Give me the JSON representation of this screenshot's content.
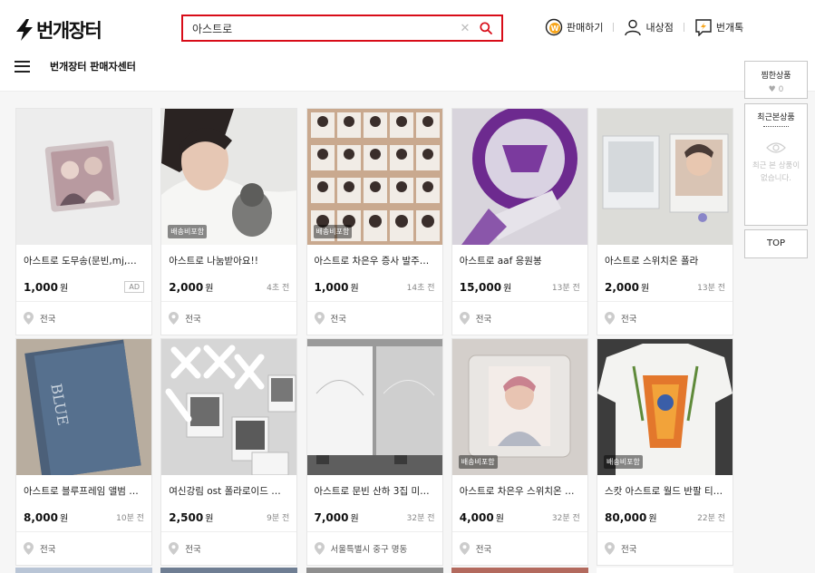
{
  "header": {
    "logo": "번개장터",
    "search": {
      "value": "아스트로",
      "placeholder": ""
    },
    "menu": [
      {
        "label": "판매하기",
        "icon": "sell-won-icon"
      },
      {
        "label": "내상점",
        "icon": "user-icon"
      },
      {
        "label": "번개톡",
        "icon": "chat-icon"
      }
    ],
    "seller_center": "번개장터 판매자센터"
  },
  "products": [
    {
      "title": "아스트로 도무송(문빈,mj,차…",
      "price": "1,000",
      "unit": "원",
      "time": "",
      "ad": "AD",
      "badge": "",
      "location": "전국"
    },
    {
      "title": "아스트로 나눔받아요!!",
      "price": "2,000",
      "unit": "원",
      "time": "4초 전",
      "ad": "",
      "badge": "배송비포함",
      "location": "전국"
    },
    {
      "title": "아스트로 차은우 증사 발주한…",
      "price": "1,000",
      "unit": "원",
      "time": "14초 전",
      "ad": "",
      "badge": "배송비포함",
      "location": "전국"
    },
    {
      "title": "아스트로 aaf 응원봉",
      "price": "15,000",
      "unit": "원",
      "time": "13분 전",
      "ad": "",
      "badge": "",
      "location": "전국"
    },
    {
      "title": "아스트로 스위치온 폴라",
      "price": "2,000",
      "unit": "원",
      "time": "13분 전",
      "ad": "",
      "badge": "",
      "location": "전국"
    },
    {
      "title": "아스트로 블루프레임 앨범 일괄",
      "price": "8,000",
      "unit": "원",
      "time": "10분 전",
      "ad": "",
      "badge": "",
      "location": "전국"
    },
    {
      "title": "여신강림 ost 폴라로이드 아…",
      "price": "2,500",
      "unit": "원",
      "time": "9분 전",
      "ad": "",
      "badge": "",
      "location": "전국"
    },
    {
      "title": "아스트로 문빈 산하 3집 미개…",
      "price": "7,000",
      "unit": "원",
      "time": "32분 전",
      "ad": "",
      "badge": "",
      "location": "서울특별시 중구 명동"
    },
    {
      "title": "아스트로 차은우 스위치온 포…",
      "price": "4,000",
      "unit": "원",
      "time": "32분 전",
      "ad": "",
      "badge": "배송비포함",
      "location": "전국"
    },
    {
      "title": "스캇 아스트로 월드 반팔 티…",
      "price": "80,000",
      "unit": "원",
      "time": "22분 전",
      "ad": "",
      "badge": "배송비포함",
      "location": "전국"
    }
  ],
  "side": {
    "wish_title": "찜한상품",
    "wish_count": "0",
    "recent_title": "최근본상품",
    "recent_empty": "최근 본 상품이 없습니다.",
    "top": "TOP"
  },
  "colors": {
    "accent": "#d80c18",
    "won_badge": "#f7a51b"
  }
}
